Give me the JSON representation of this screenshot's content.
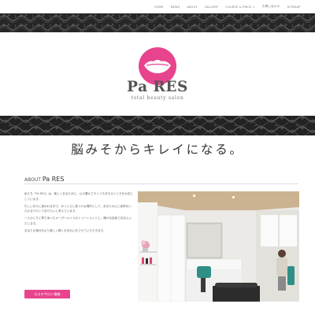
{
  "nav": {
    "items": [
      "HOME",
      "NEWS",
      "ABOUT",
      "GALLERY",
      "COURSE & PRICE ∨",
      "お問い合わせ",
      "SITEMAP"
    ]
  },
  "logo": {
    "name": "Pa RES",
    "tagline": "total beauty salon",
    "brand_color": "#e8448e"
  },
  "headline": "脳みそからキレイになる。",
  "about": {
    "prefix": "ABOUT",
    "name": "Pa RES",
    "paragraphs": [
      "私たち「Pa RES」は、美しくあるために、心の豊かさやくつろぎのひとときを大切にしています。",
      "忙しい日々に追われる中で、ほっとひと息つける場所として、あなたの心と身体をいたわるサロンでありたいと考えています。",
      "一人ひとりに寄り添ったオーダーメイドのトリートメントと、確かな技術でお応えいたします。",
      "あなたの毎日がより美しく輝くお手伝いをさせていただきます。"
    ]
  },
  "cta": {
    "label": "エステサロン情報"
  },
  "colors": {
    "accent": "#e8448e",
    "lace": "#2a2a2a"
  }
}
